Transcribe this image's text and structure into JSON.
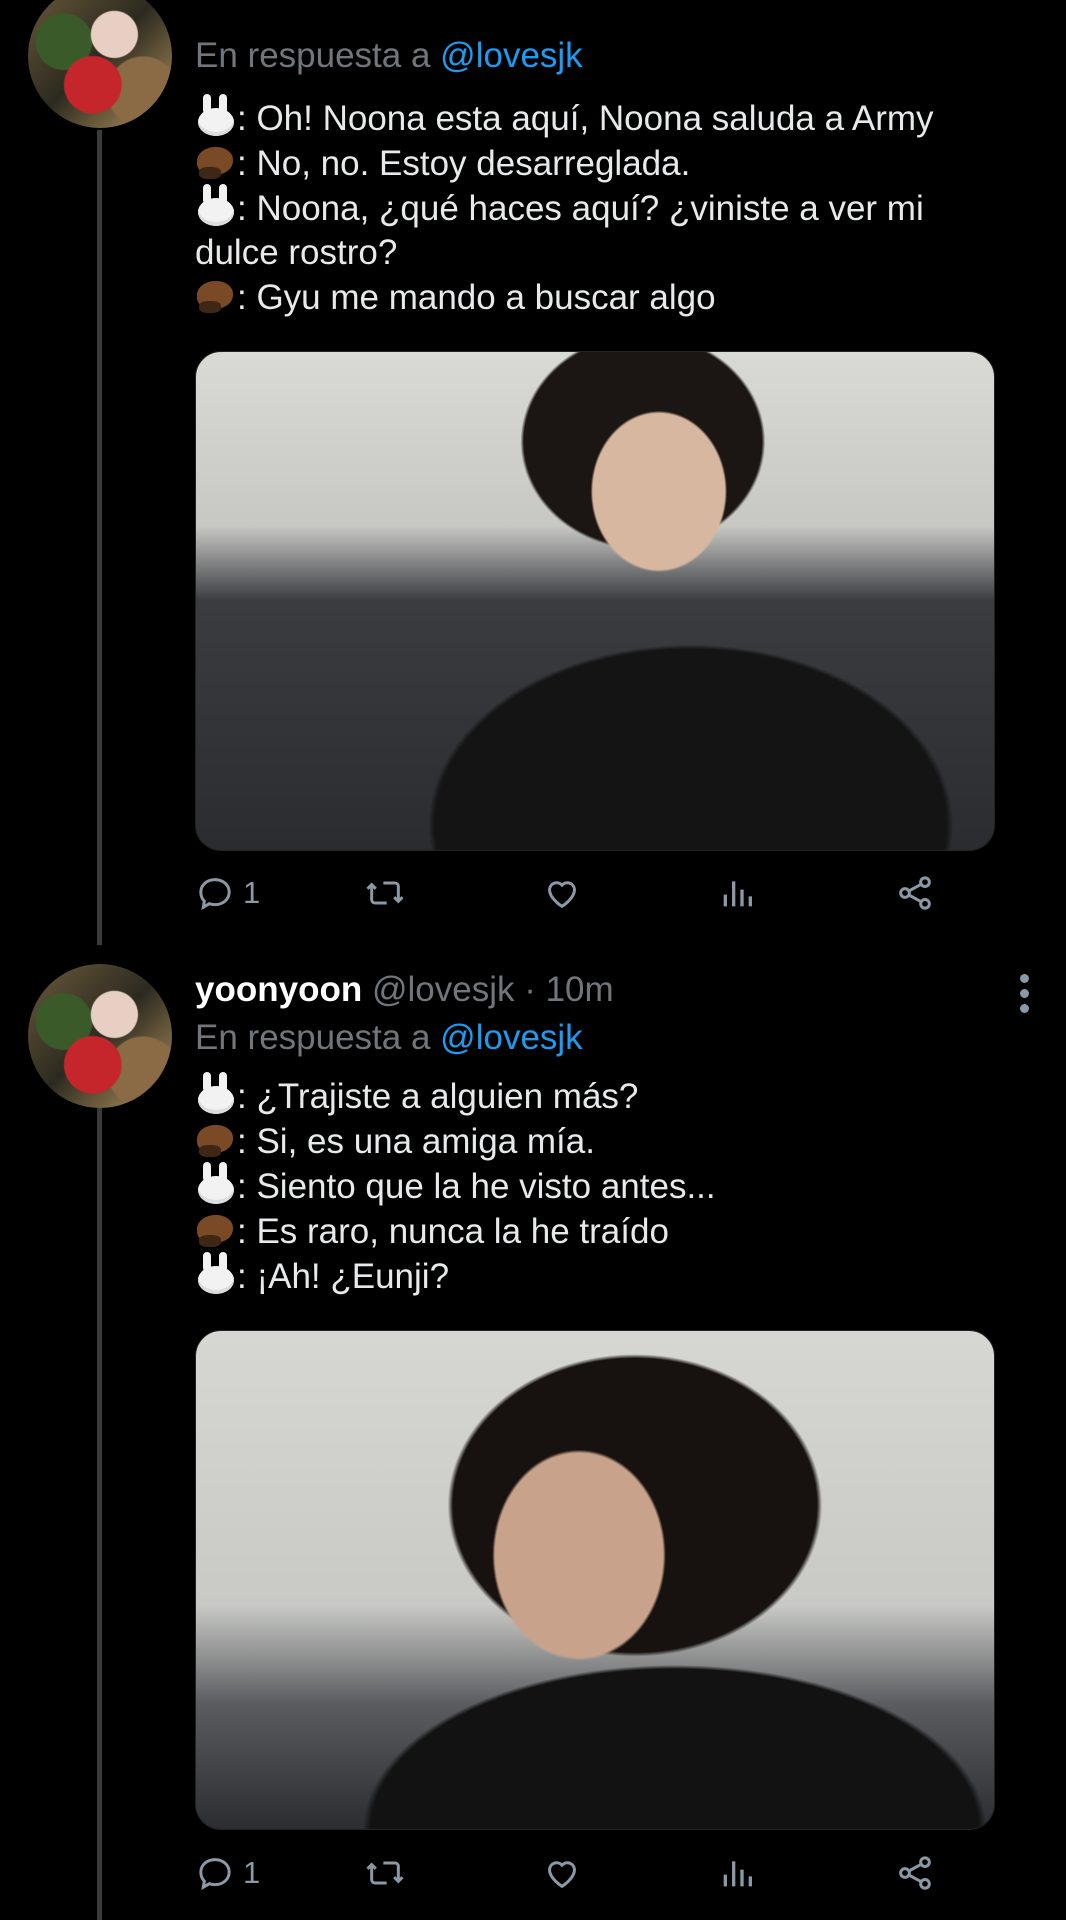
{
  "tweets": [
    {
      "reply_to_label": "En respuesta a",
      "reply_to_handle": "@lovesjk",
      "lines": [
        {
          "speaker": "bunny",
          "text": ": Oh! Noona esta aquí, Noona saluda a Army"
        },
        {
          "speaker": "beaver",
          "text": ": No, no. Estoy desarreglada."
        },
        {
          "speaker": "bunny",
          "text": ": Noona, ¿qué haces aquí? ¿viniste a ver mi"
        },
        {
          "speaker": "",
          "text": "dulce rostro?"
        },
        {
          "speaker": "beaver",
          "text": ": Gyu me mando a buscar algo"
        }
      ],
      "reply_count": "1"
    },
    {
      "display_name": "yoonyoon",
      "handle": "@lovesjk",
      "time": "· 10m",
      "reply_to_label": "En respuesta a",
      "reply_to_handle": "@lovesjk",
      "lines": [
        {
          "speaker": "bunny",
          "text": ": ¿Trajiste a alguien más?"
        },
        {
          "speaker": "beaver",
          "text": ": Si, es una amiga mía."
        },
        {
          "speaker": "bunny",
          "text": ": Siento que la he visto antes..."
        },
        {
          "speaker": "beaver",
          "text": ": Es raro, nunca la he traído"
        },
        {
          "speaker": "bunny",
          "text": ": ¡Ah! ¿Eunji?"
        }
      ],
      "reply_count": "1"
    }
  ],
  "icons": {
    "reply": "reply-icon",
    "retweet": "retweet-icon",
    "like": "heart-icon",
    "views": "views-icon",
    "share": "share-icon",
    "speaker_bunny": "rabbit-face-emoji",
    "speaker_beaver": "beaver-emoji"
  },
  "colors": {
    "background": "#000000",
    "text": "#e7e9ea",
    "muted": "#71767b",
    "link": "#1d9bf0",
    "thread_line": "#3b3b3b"
  }
}
